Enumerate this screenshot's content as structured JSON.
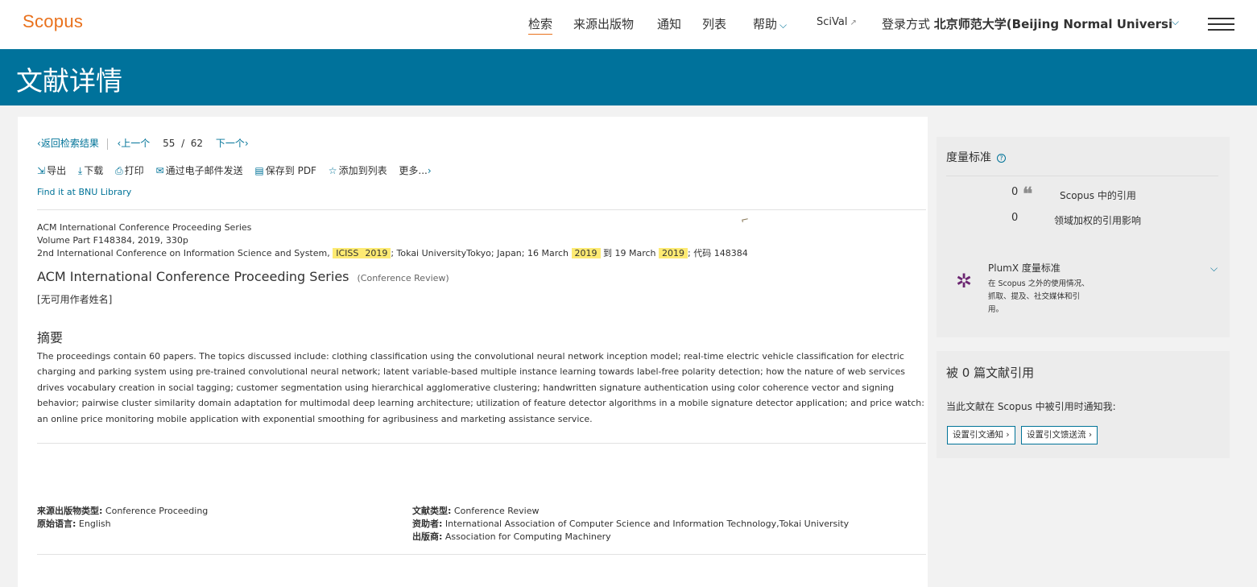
{
  "nav": {
    "logo": "Scopus",
    "links": [
      "检索",
      "来源出版物",
      "通知",
      "列表",
      "帮助"
    ],
    "scival": "SciVal",
    "login_prefix": "登录方式",
    "institution": "北京师范大学(Beijing Normal Universi"
  },
  "banner": {
    "title": "文献详情"
  },
  "pager": {
    "back": "返回检索结果",
    "prev": "上一个",
    "current": "55",
    "slash": "/",
    "total": "62",
    "next": "下一个"
  },
  "toolbar": {
    "export": "导出",
    "download": "下载",
    "print": "打印",
    "email": "通过电子邮件发送",
    "save_pdf": "保存到 PDF",
    "add_list": "添加到列表",
    "more": "更多..."
  },
  "findit": "Find it at BNU Library",
  "source": {
    "series": "ACM International Conference Proceeding Series",
    "volume": "Volume Part F148384, 2019, 330p",
    "conf_pre": "2nd International Conference on Information Science and System, ",
    "hl_iciss": "ICISS",
    "hl_2019": "2019",
    "conf_mid1": "; Tokai UniversityTokyo; Japan; 16 March ",
    "conf_mid2": " 到 19 March ",
    "conf_post": "; 代码 148384"
  },
  "document": {
    "title": "ACM International Conference Proceeding Series",
    "type": "(Conference Review)",
    "authors": "[无可用作者姓名]"
  },
  "abstract": {
    "heading": "摘要",
    "text": "The proceedings contain 60 papers. The topics discussed include: clothing classification using the convolutional neural network inception model; real-time electric vehicle classification for electric charging and parking system using pre-trained convolutional neural network; latent variable-based multiple instance learning towards label-free polarity detection; how the nature of web services drives vocabulary creation in social tagging; customer segmentation using hierarchical agglomerative clustering; handwritten signature authentication using color coherence vector and signing behavior; pairwise cluster similarity domain adaptation for multimodal deep learning architecture; utilization of feature detector algorithms in a mobile signature detector application; and price watch: an online price monitoring mobile application with exponential smoothing for agribusiness and marketing assistance service."
  },
  "meta": {
    "source_type_label": "来源出版物类型:",
    "source_type": "Conference Proceeding",
    "language_label": "原始语言:",
    "language": "English",
    "doc_type_label": "文献类型:",
    "doc_type": "Conference Review",
    "sponsor_label": "资助者:",
    "sponsor": "International Association of Computer Science and Information Technology,Tokai University",
    "publisher_label": "出版商:",
    "publisher": "Association for Computing Machinery"
  },
  "metrics": {
    "title": "度量标准",
    "citations_count": "0",
    "citations_label": "Scopus 中的引用",
    "fwci_count": "0",
    "fwci_label": "领域加权的引用影响",
    "plumx_title": "PlumX 度量标准",
    "plumx_desc": "在 Scopus 之外的使用情况、抓取、提及、社交媒体和引用。"
  },
  "cited_by": {
    "title": "被 0 篇文献引用",
    "desc": "当此文献在 Scopus 中被引用时通知我:",
    "btn_alert": "设置引文通知",
    "btn_feed": "设置引文馈送流"
  },
  "colors": {
    "brand_orange": "#e9711c",
    "banner_blue": "#00729b",
    "link_blue": "#007398",
    "highlight": "#fdea72",
    "plumx_purple": "#6b2571"
  },
  "icons": [
    "export-icon",
    "download-icon",
    "print-icon",
    "email-icon",
    "pdf-icon",
    "star-icon",
    "quote-icon",
    "plumx-icon",
    "help-icon",
    "hamburger-icon"
  ]
}
